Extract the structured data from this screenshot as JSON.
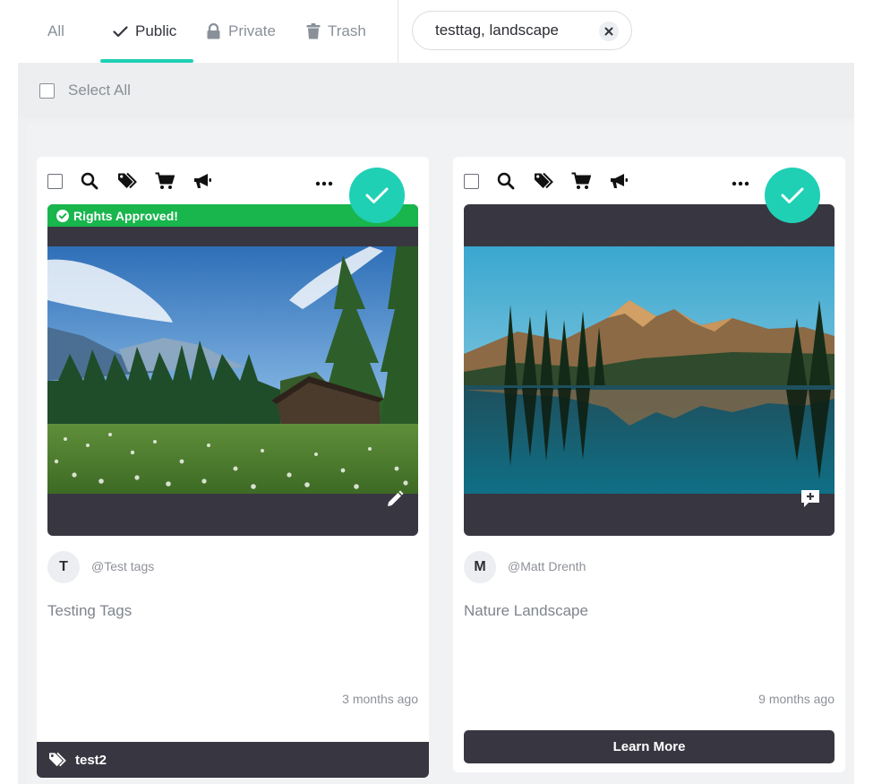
{
  "tabs": [
    {
      "label": "All",
      "icon": "none",
      "active": false
    },
    {
      "label": "Public",
      "icon": "check-icon",
      "active": true
    },
    {
      "label": "Private",
      "icon": "lock-icon",
      "active": false
    },
    {
      "label": "Trash",
      "icon": "trash-icon",
      "active": false
    }
  ],
  "search": {
    "value": "testtag, landscape"
  },
  "select_all_label": "Select All",
  "colors": {
    "accent": "#1fd0b5",
    "rights_green": "#19b54d",
    "dark": "#383741"
  },
  "cards": [
    {
      "rights_label": "Rights Approved!",
      "avatar_initial": "T",
      "handle": "@Test tags",
      "title": "Testing Tags",
      "date": "3 months ago",
      "tag": "test2",
      "photo": "meadow-cabin-forest-photo",
      "media_action_icon": "pencil-icon"
    },
    {
      "avatar_initial": "M",
      "handle": "@Matt Drenth",
      "title": "Nature Landscape",
      "date": "9 months ago",
      "cta": "Learn More",
      "photo": "mountain-lake-reflection-photo",
      "media_action_icon": "comment-plus-icon"
    }
  ]
}
